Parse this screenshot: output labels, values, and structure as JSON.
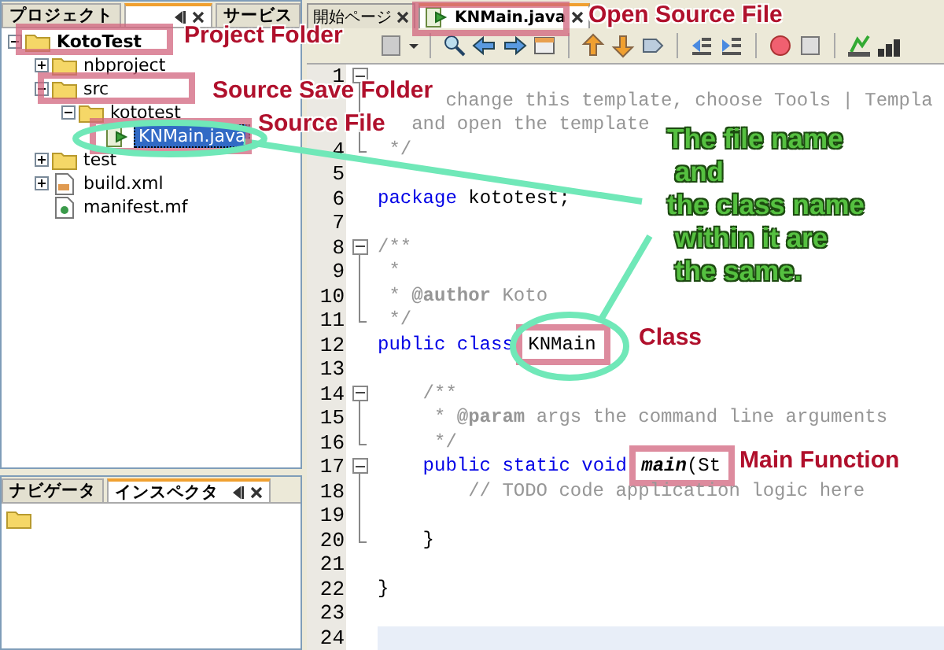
{
  "projects_panel": {
    "tabs": [
      {
        "label": "プロジェクト",
        "selected": false
      },
      {
        "selected": true
      },
      {
        "label": "サービス",
        "selected": false
      }
    ],
    "tree": [
      {
        "label": "KotoTest",
        "kind": "project",
        "expanded": true,
        "selected": false,
        "children": [
          {
            "label": "nbproject",
            "kind": "folder",
            "expanded": false,
            "selected": false
          },
          {
            "label": "src",
            "kind": "folder",
            "expanded": true,
            "selected": false,
            "children": [
              {
                "label": "kototest",
                "kind": "folder",
                "expanded": true,
                "selected": false,
                "children": [
                  {
                    "label": "KNMain.java",
                    "kind": "java",
                    "selected": true
                  }
                ]
              }
            ]
          },
          {
            "label": "test",
            "kind": "folder",
            "expanded": false,
            "selected": false
          },
          {
            "label": "build.xml",
            "kind": "xml",
            "expanded": false,
            "selected": false
          },
          {
            "label": "manifest.mf",
            "kind": "manifest",
            "selected": false
          }
        ]
      }
    ]
  },
  "inspector_panel": {
    "tabs": [
      {
        "label": "ナビゲータ",
        "selected": false
      },
      {
        "label": "インスペクタ",
        "selected": true
      }
    ]
  },
  "editor": {
    "tabs": [
      {
        "label": "開始ページ",
        "kind": "page",
        "selected": false
      },
      {
        "label": "KNMain.java",
        "kind": "java",
        "selected": true
      }
    ],
    "lines": [
      {
        "number": "1",
        "kind": "fold_start"
      },
      {
        "segments": [
          {
            "kind": "comment",
            "text": "      change this template, choose Tools | Templa"
          }
        ]
      },
      {
        "segments": [
          {
            "kind": "comment",
            "text": "   and open the template"
          }
        ]
      },
      {
        "number": "4",
        "kind": "fold_end",
        "segments": [
          {
            "kind": "comment",
            "text": " */"
          }
        ]
      },
      {
        "number": "5"
      },
      {
        "number": "6",
        "segments": [
          {
            "kind": "keyword",
            "text": "package"
          },
          {
            "kind": "plain",
            "text": " kototest;"
          }
        ]
      },
      {
        "number": "7"
      },
      {
        "number": "8",
        "kind": "fold_start",
        "segments": [
          {
            "kind": "comment",
            "text": "/**"
          }
        ]
      },
      {
        "number": "9",
        "segments": [
          {
            "kind": "comment",
            "text": " *"
          }
        ]
      },
      {
        "number": "10",
        "segments": [
          {
            "kind": "comment",
            "text": " * "
          },
          {
            "kind": "tag",
            "text": "@author"
          },
          {
            "kind": "comment",
            "text": " Koto"
          }
        ]
      },
      {
        "number": "11",
        "kind": "fold_end",
        "segments": [
          {
            "kind": "comment",
            "text": " */"
          }
        ]
      },
      {
        "number": "12",
        "segments": [
          {
            "kind": "keyword",
            "text": "public class "
          },
          {
            "kind": "plain",
            "text": "KNMain",
            "highlighted": true
          }
        ]
      },
      {
        "number": "13"
      },
      {
        "number": "14",
        "kind": "fold_start",
        "segments": [
          {
            "kind": "comment",
            "text": "    /**"
          }
        ]
      },
      {
        "number": "15",
        "segments": [
          {
            "kind": "comment",
            "text": "     * "
          },
          {
            "kind": "tag",
            "text": "@param"
          },
          {
            "kind": "comment",
            "text": " args the command line arguments"
          }
        ]
      },
      {
        "number": "16",
        "kind": "fold_end",
        "segments": [
          {
            "kind": "comment",
            "text": "     */"
          }
        ]
      },
      {
        "number": "17",
        "kind": "fold_start",
        "segments": [
          {
            "kind": "keyword",
            "text": "    public static void "
          },
          {
            "kind": "method",
            "text": "main",
            "highlighted": true
          },
          {
            "kind": "plain",
            "text": "(St",
            "highlighted": true
          }
        ]
      },
      {
        "number": "18",
        "segments": [
          {
            "kind": "comment",
            "text": "        // TODO code application logic here"
          }
        ]
      },
      {
        "number": "19"
      },
      {
        "number": "20",
        "kind": "fold_end",
        "segments": [
          {
            "kind": "plain",
            "text": "    }"
          }
        ]
      },
      {
        "number": "21"
      },
      {
        "number": "22",
        "segments": [
          {
            "kind": "plain",
            "text": "}"
          }
        ]
      },
      {
        "number": "23"
      },
      {
        "number": "24",
        "current": true
      }
    ]
  },
  "annotations": [
    {
      "text": "Project Folder"
    },
    {
      "text": "Source Save Folder"
    },
    {
      "text": "Source File"
    },
    {
      "text": "Open Source File"
    },
    {
      "text": "Class"
    },
    {
      "text": "Main Function"
    }
  ],
  "note": {
    "lines": [
      "The file name",
      " and",
      "the class name",
      " within it are",
      " the same."
    ]
  }
}
